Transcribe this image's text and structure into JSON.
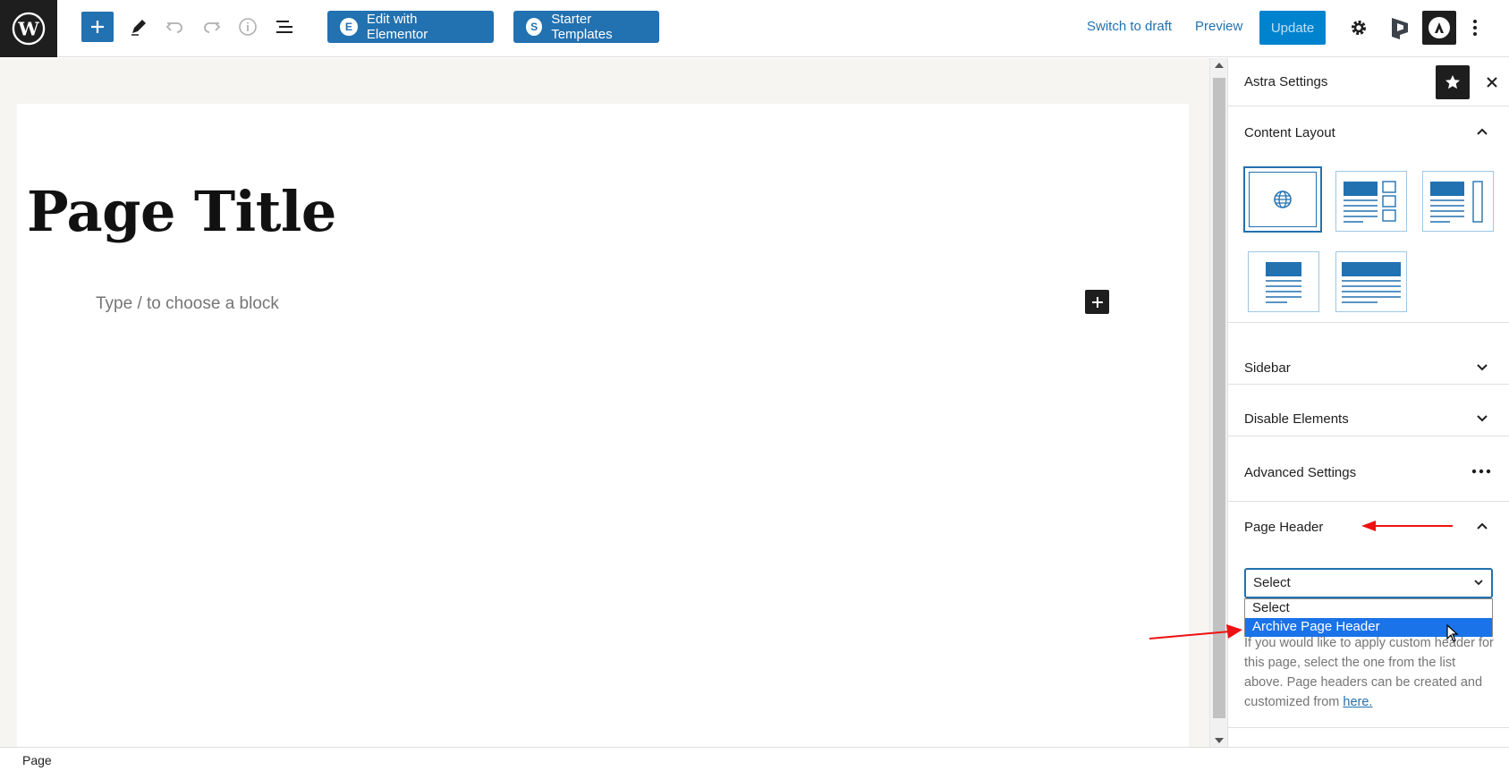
{
  "toolbar": {
    "edit_elementor": "Edit with Elementor",
    "elementor_badge": "E",
    "starter_templates": "Starter Templates",
    "starter_badge": "S",
    "switch_to_draft": "Switch to draft",
    "preview": "Preview",
    "update": "Update"
  },
  "editor": {
    "page_title": "Page Title",
    "block_placeholder": "Type / to choose a block"
  },
  "sidebar": {
    "title": "Astra Settings",
    "panels": {
      "content_layout": "Content Layout",
      "sidebar": "Sidebar",
      "disable_elements": "Disable Elements",
      "advanced_settings": "Advanced Settings",
      "page_header": "Page Header"
    },
    "page_header_select": {
      "value": "Select",
      "options": [
        "Select",
        "Archive Page Header"
      ],
      "highlighted": "Archive Page Header"
    },
    "help_text": "If you would like to apply custom header for this page, select the one from the list above. Page headers can be created and customized from",
    "help_link": "here."
  },
  "footer": {
    "breadcrumb": "Page"
  },
  "colors": {
    "accent": "#2271b1",
    "update_bg": "#0083cf",
    "annotation": "#e11"
  }
}
